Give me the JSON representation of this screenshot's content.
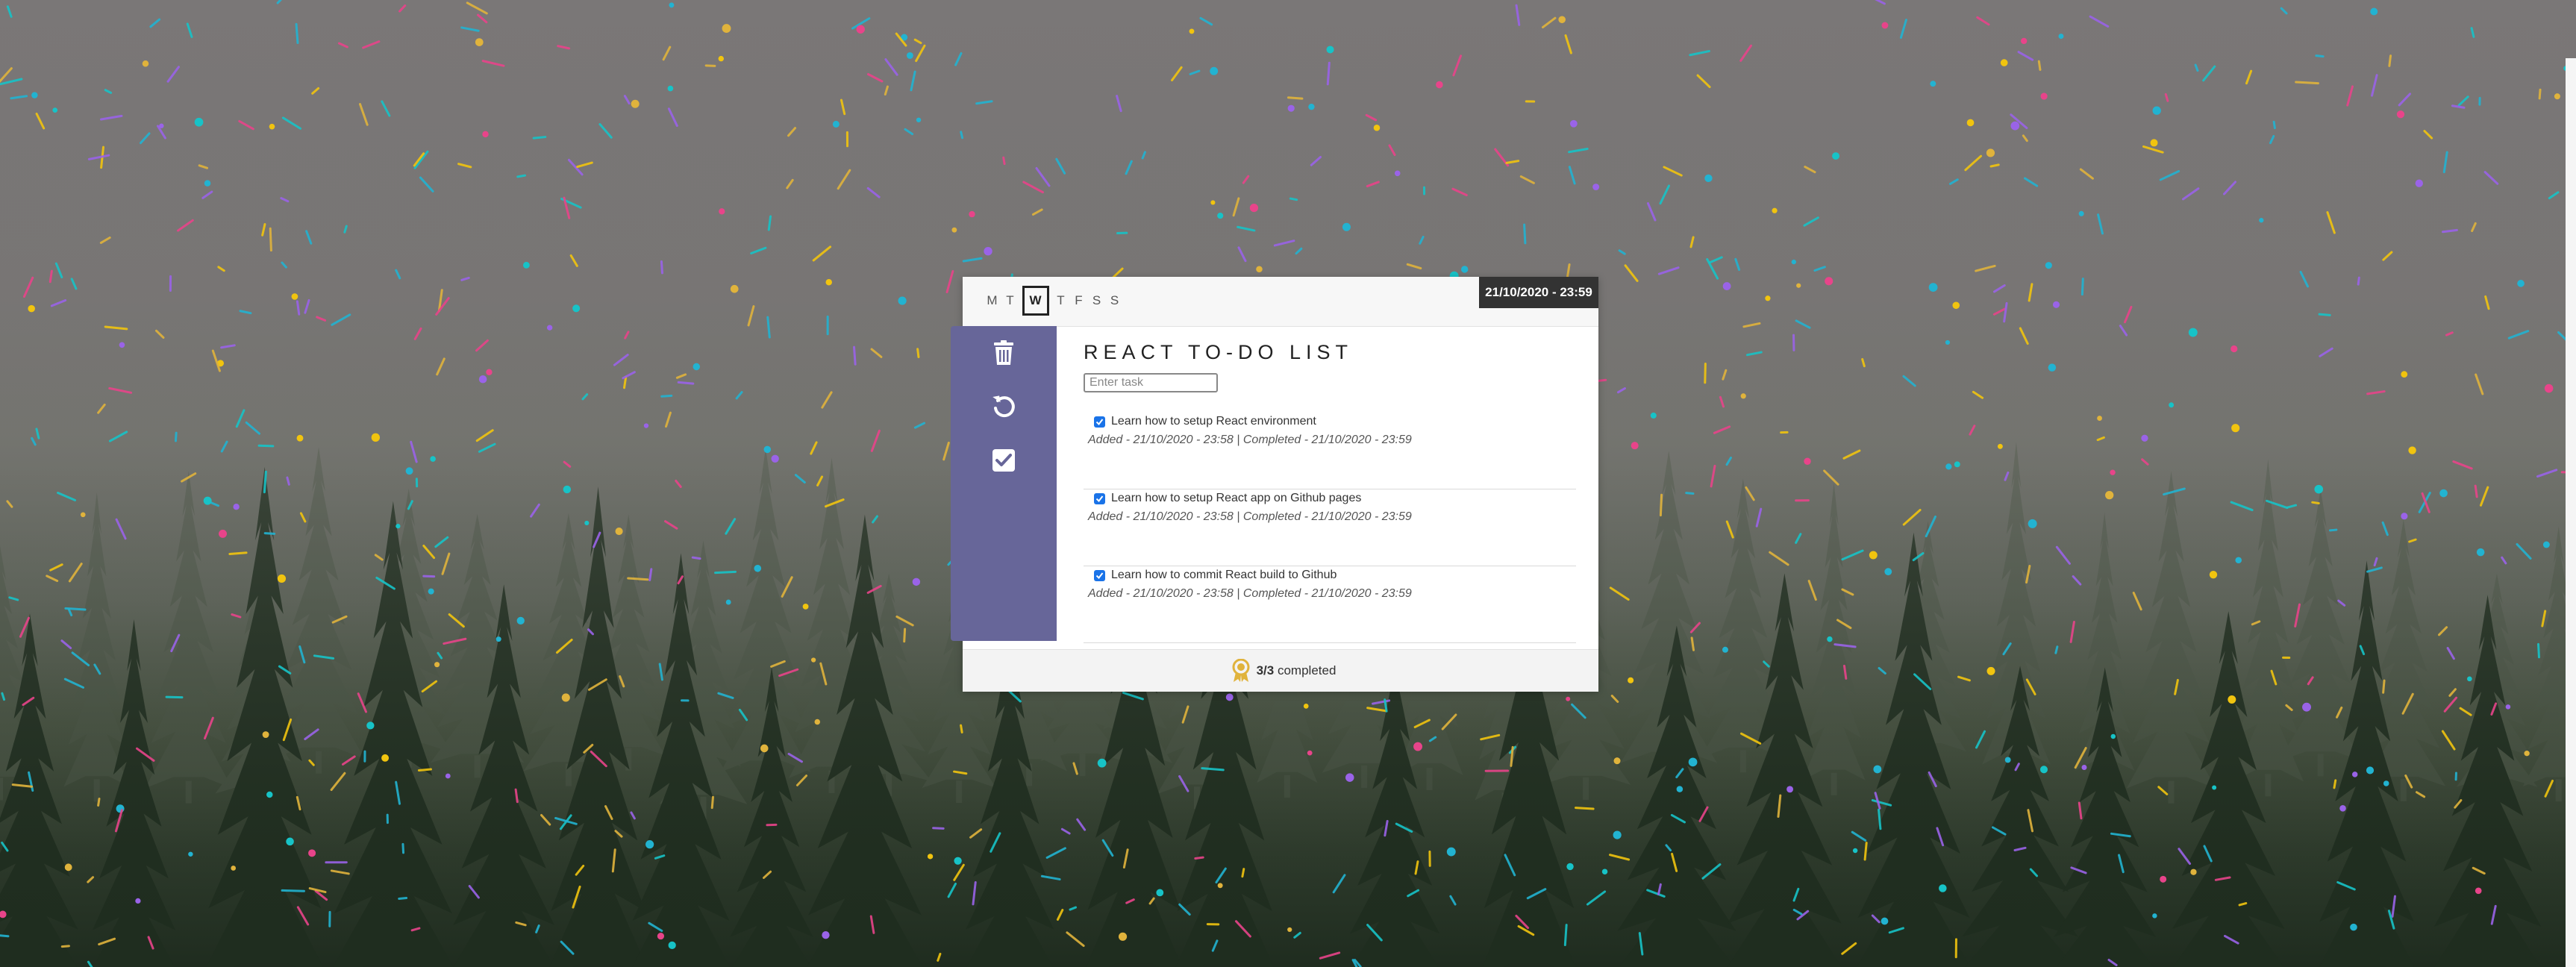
{
  "header": {
    "days": [
      "M",
      "T",
      "W",
      "T",
      "F",
      "S",
      "S"
    ],
    "active_day": "W",
    "datetime": "21/10/2020 - 23:59"
  },
  "sidebar": {
    "buttons": [
      {
        "icon": "trash-icon"
      },
      {
        "icon": "undo-icon"
      },
      {
        "icon": "check-square-icon"
      }
    ],
    "color": "#676699"
  },
  "main": {
    "title": "REACT TO-DO LIST",
    "input_placeholder": "Enter task",
    "input_value": ""
  },
  "tasks": [
    {
      "text": "Learn how to setup React environment",
      "checked": true,
      "meta": "Added - 21/10/2020 - 23:58 | Completed - 21/10/2020 - 23:59"
    },
    {
      "text": "Learn how to setup React app on Github pages",
      "checked": true,
      "meta": "Added - 21/10/2020 - 23:58 | Completed - 21/10/2020 - 23:59"
    },
    {
      "text": "Learn how to commit React build to Github",
      "checked": true,
      "meta": "Added - 21/10/2020 - 23:58 | Completed - 21/10/2020 - 23:59"
    }
  ],
  "footer": {
    "icon": "award-icon",
    "count": "3/3",
    "label": "completed"
  },
  "colors": {
    "accent": "#676699",
    "checkbox": "#1a73e8",
    "badge": "#333333",
    "award": "#e0b33c"
  }
}
